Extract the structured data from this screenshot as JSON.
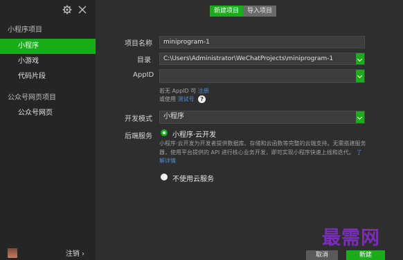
{
  "sidebar": {
    "group1": "小程序项目",
    "items1": [
      "小程序",
      "小游戏",
      "代码片段"
    ],
    "group2": "公众号网页项目",
    "items2": [
      "公众号网页"
    ],
    "logout": "注销 ›"
  },
  "tabs": {
    "new": "新建项目",
    "import": "导入项目"
  },
  "form": {
    "name_label": "项目名称",
    "name_value": "miniprogram-1",
    "dir_label": "目录",
    "dir_value": "C:\\Users\\Administrator\\WeChatProjects\\miniprogram-1",
    "appid_label": "AppID",
    "appid_value": "",
    "hint1_prefix": "若无 AppID 可",
    "hint1_link": "注册",
    "hint2_prefix": "或使用",
    "hint2_link": "测试号",
    "mode_label": "开发模式",
    "mode_value": "小程序",
    "backend_label": "后端服务",
    "cloud_option": "小程序·云开发",
    "cloud_desc": "小程序·云开发为开发者提供数据库、存储和云函数等完整的云端支持。无需搭建服务器，使用平台提供的 API 进行核心业务开发，即可实现小程序快速上线和迭代。",
    "cloud_link": "了解详情",
    "no_cloud_option": "不使用云服务"
  },
  "buttons": {
    "cancel": "取消",
    "create": "新建"
  },
  "watermark": "最需网",
  "colors": {
    "accent": "#1aad19",
    "link": "#4f8bd6",
    "background": "#2e2e2e",
    "sidebar": "#252526"
  }
}
